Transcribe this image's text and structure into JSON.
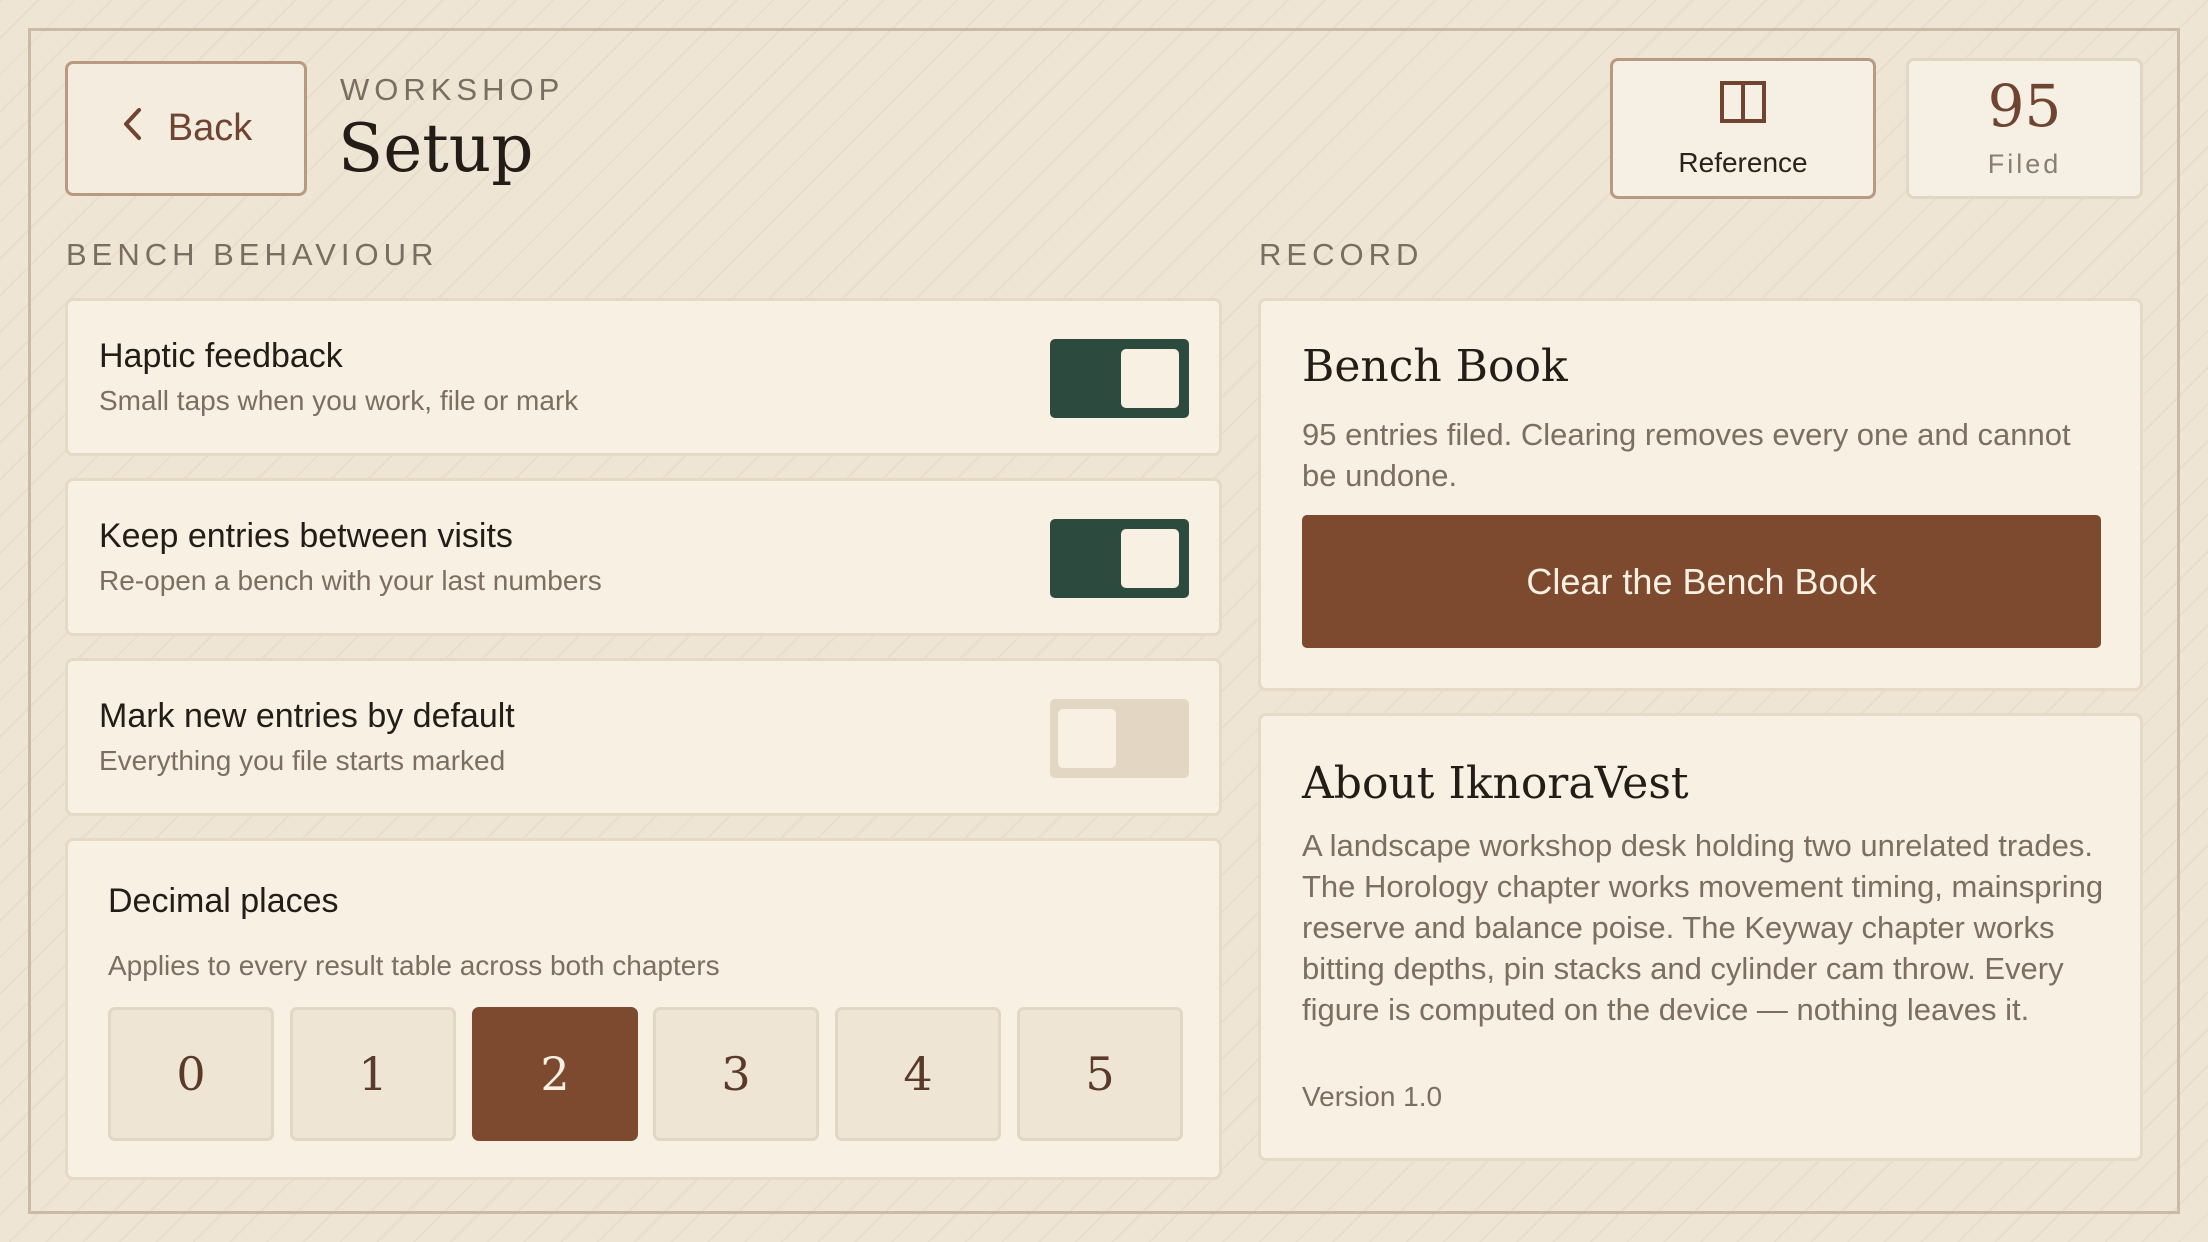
{
  "header": {
    "back_label": "Back",
    "eyebrow": "WORKSHOP",
    "title": "Setup",
    "reference_label": "Reference",
    "filed_count": "95",
    "filed_label": "Filed"
  },
  "bench": {
    "section_label": "BENCH BEHAVIOUR",
    "toggles": [
      {
        "title": "Haptic feedback",
        "subtitle": "Small taps when you work, file or mark",
        "on": true
      },
      {
        "title": "Keep entries between visits",
        "subtitle": "Re-open a bench with your last numbers",
        "on": true
      },
      {
        "title": "Mark new entries by default",
        "subtitle": "Everything you file starts marked",
        "on": false
      }
    ],
    "decimal": {
      "title": "Decimal places",
      "subtitle": "Applies to every result table across both chapters",
      "options": [
        "0",
        "1",
        "2",
        "3",
        "4",
        "5"
      ],
      "selected": "2"
    }
  },
  "record": {
    "section_label": "RECORD",
    "book_title": "Bench Book",
    "book_text": "95 entries filed. Clearing removes every one and cannot be undone.",
    "clear_label": "Clear the Bench Book",
    "about_title": "About IknoraVest",
    "about_text": "A landscape workshop desk holding two unrelated trades. The Horology chapter works movement timing, mainspring reserve and balance poise. The Keyway chapter works bitting depths, pin stacks and cylinder cam throw. Every figure is computed on the device — nothing leaves it.",
    "version": "Version 1.0"
  },
  "colors": {
    "background": "#efe5d4",
    "accent_brown": "#7d4a2f",
    "toggle_on": "#2d4a3e",
    "toggle_off": "#e3d7c3"
  }
}
